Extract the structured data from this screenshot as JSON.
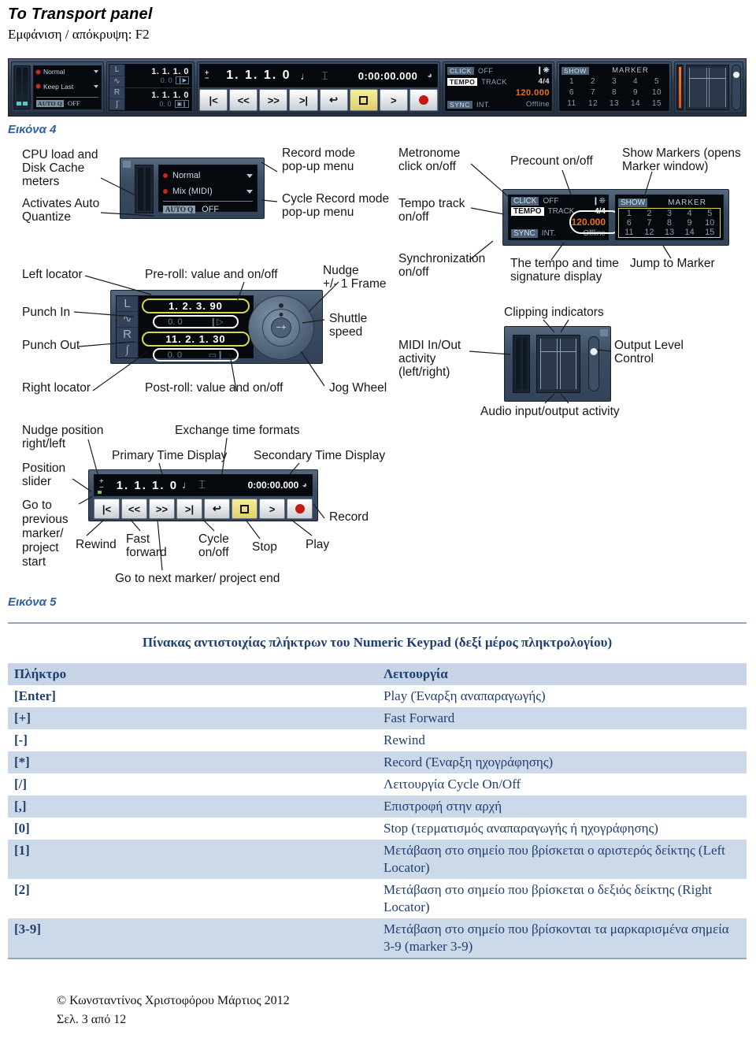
{
  "header": {
    "title": "Το Transport panel",
    "subtitle": "Εμφάνιση / απόκρυψη: F2"
  },
  "figure4": {
    "label": "Εικόνα 4",
    "annotations": [
      "CPU load and\nDisk Cache\nmeters",
      "Activates Auto\nQuantize",
      "Record mode\npop-up menu",
      "Cycle Record mode\npop-up menu",
      "Metronome\nclick on/off",
      "Tempo track\non/off",
      "Precount on/off",
      "Show Markers (opens\nMarker window)",
      "Left locator",
      "Punch In",
      "Punch Out",
      "Right locator",
      "Pre-roll: value and on/off",
      "Post-roll: value and on/off",
      "Nudge\n+/- 1 Frame",
      "Shuttle\nspeed",
      "Jog Wheel",
      "Synchronization\non/off",
      "The tempo and time\nsignature display",
      "Jump to Marker",
      "Clipping indicators",
      "MIDI In/Out\nactivity\n(left/right)",
      "Output Level\nControl",
      "Audio input/output activity",
      "Nudge position\nright/left",
      "Position\nslider",
      "Go to\nprevious\nmarker/\nproject\nstart",
      "Primary Time Display",
      "Exchange time formats",
      "Secondary Time Display",
      "Rewind",
      "Fast\nforward",
      "Cycle\non/off",
      "Stop",
      "Play",
      "Record",
      "Go to next marker/ project end"
    ]
  },
  "transport": {
    "record_mode": "Normal",
    "cycle_record_mode_short": "Keep Last",
    "cycle_record_mode_full": "Mix (MIDI)",
    "autoq_tag": "AUTO Q",
    "autoq_value": "OFF",
    "left_locator_icon": "L",
    "right_locator_icon": "R",
    "left_locator_value": "1. 1. 1.  0",
    "right_locator_value": "1. 1. 1.  0",
    "preroll_value": "0.    0",
    "postroll_value": "0.    0",
    "fig_left_locator_value": "1. 2. 3. 90",
    "fig_right_locator_value": "11. 2. 1. 30",
    "primary_time": "1. 1. 1.    0",
    "secondary_time": "0:00:00.000",
    "click_tag": "CLICK",
    "click_value": "OFF",
    "tempo_tag": "TEMPO",
    "tempo_track_label": "TRACK",
    "time_signature": "4/4",
    "tempo_value": "120.000",
    "sync_tag": "SYNC",
    "sync_source": "INT.",
    "sync_status": "Offline",
    "show_tag": "SHOW",
    "marker_label": "MARKER",
    "markers": [
      "1",
      "2",
      "3",
      "4",
      "5",
      "6",
      "7",
      "8",
      "9",
      "10",
      "11",
      "12",
      "13",
      "14",
      "15"
    ],
    "buttons": {
      "go_to_start": "|<",
      "rewind": "<<",
      "fast_forward": ">>",
      "go_to_end": ">|",
      "cycle": "↩",
      "stop": "stop-square",
      "play": ">",
      "record": "record-dot"
    }
  },
  "figure5": {
    "label": "Εικόνα 5"
  },
  "table": {
    "caption": "Πίνακας αντιστοιχίας πλήκτρων του Numeric Keypad (δεξί  μέρος πληκτρολογίου)",
    "headers": [
      "Πλήκτρο",
      "Λειτουργία"
    ],
    "rows": [
      {
        "key": "[Enter]",
        "fn": "Play (Έναρξη αναπαραγωγής)"
      },
      {
        "key": "[+]",
        "fn": "Fast Forward"
      },
      {
        "key": "[-]",
        "fn": "Rewind"
      },
      {
        "key": "[*]",
        "fn": "Record (Έναρξη ηχογράφησης)"
      },
      {
        "key": "[/]",
        "fn": "Λειτουργία Cycle On/Off"
      },
      {
        "key": "[,]",
        "fn": "Επιστροφή στην αρχή"
      },
      {
        "key": "[0]",
        "fn": "Stop (τερματισμός αναπαραγωγής ή ηχογράφησης)"
      },
      {
        "key": "[1]",
        "fn": "Μετάβαση στο σημείο που βρίσκεται ο αριστερός δείκτης (Left Locator)"
      },
      {
        "key": "[2]",
        "fn": "Μετάβαση στο σημείο που βρίσκεται ο δεξιός δείκτης (Right Locator)"
      },
      {
        "key": "[3-9]",
        "fn": "Μετάβαση στο σημείο που βρίσκονται τα μαρκαρισμένα σημεία 3-9  (marker 3-9)"
      }
    ]
  },
  "footer": {
    "copyright": "© Κωνσταντίνος Χριστοφόρου Μάρτιος 2012",
    "page": "Σελ. 3 από 12"
  },
  "colors": {
    "accent_blue": "#2e5f9e",
    "table_text": "#1f3f73",
    "table_shade": "#ccd9e9",
    "tempo_orange": "#e8751a"
  }
}
